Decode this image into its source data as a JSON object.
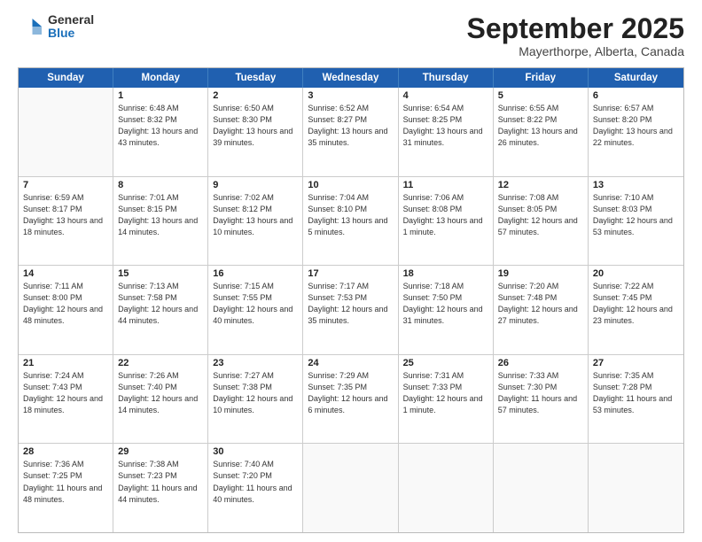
{
  "logo": {
    "general": "General",
    "blue": "Blue"
  },
  "title": "September 2025",
  "location": "Mayerthorpe, Alberta, Canada",
  "days_of_week": [
    "Sunday",
    "Monday",
    "Tuesday",
    "Wednesday",
    "Thursday",
    "Friday",
    "Saturday"
  ],
  "weeks": [
    [
      {
        "day": "",
        "empty": true
      },
      {
        "day": "1",
        "sunrise": "6:48 AM",
        "sunset": "8:32 PM",
        "daylight": "13 hours and 43 minutes."
      },
      {
        "day": "2",
        "sunrise": "6:50 AM",
        "sunset": "8:30 PM",
        "daylight": "13 hours and 39 minutes."
      },
      {
        "day": "3",
        "sunrise": "6:52 AM",
        "sunset": "8:27 PM",
        "daylight": "13 hours and 35 minutes."
      },
      {
        "day": "4",
        "sunrise": "6:54 AM",
        "sunset": "8:25 PM",
        "daylight": "13 hours and 31 minutes."
      },
      {
        "day": "5",
        "sunrise": "6:55 AM",
        "sunset": "8:22 PM",
        "daylight": "13 hours and 26 minutes."
      },
      {
        "day": "6",
        "sunrise": "6:57 AM",
        "sunset": "8:20 PM",
        "daylight": "13 hours and 22 minutes."
      }
    ],
    [
      {
        "day": "7",
        "sunrise": "6:59 AM",
        "sunset": "8:17 PM",
        "daylight": "13 hours and 18 minutes."
      },
      {
        "day": "8",
        "sunrise": "7:01 AM",
        "sunset": "8:15 PM",
        "daylight": "13 hours and 14 minutes."
      },
      {
        "day": "9",
        "sunrise": "7:02 AM",
        "sunset": "8:12 PM",
        "daylight": "13 hours and 10 minutes."
      },
      {
        "day": "10",
        "sunrise": "7:04 AM",
        "sunset": "8:10 PM",
        "daylight": "13 hours and 5 minutes."
      },
      {
        "day": "11",
        "sunrise": "7:06 AM",
        "sunset": "8:08 PM",
        "daylight": "13 hours and 1 minute."
      },
      {
        "day": "12",
        "sunrise": "7:08 AM",
        "sunset": "8:05 PM",
        "daylight": "12 hours and 57 minutes."
      },
      {
        "day": "13",
        "sunrise": "7:10 AM",
        "sunset": "8:03 PM",
        "daylight": "12 hours and 53 minutes."
      }
    ],
    [
      {
        "day": "14",
        "sunrise": "7:11 AM",
        "sunset": "8:00 PM",
        "daylight": "12 hours and 48 minutes."
      },
      {
        "day": "15",
        "sunrise": "7:13 AM",
        "sunset": "7:58 PM",
        "daylight": "12 hours and 44 minutes."
      },
      {
        "day": "16",
        "sunrise": "7:15 AM",
        "sunset": "7:55 PM",
        "daylight": "12 hours and 40 minutes."
      },
      {
        "day": "17",
        "sunrise": "7:17 AM",
        "sunset": "7:53 PM",
        "daylight": "12 hours and 35 minutes."
      },
      {
        "day": "18",
        "sunrise": "7:18 AM",
        "sunset": "7:50 PM",
        "daylight": "12 hours and 31 minutes."
      },
      {
        "day": "19",
        "sunrise": "7:20 AM",
        "sunset": "7:48 PM",
        "daylight": "12 hours and 27 minutes."
      },
      {
        "day": "20",
        "sunrise": "7:22 AM",
        "sunset": "7:45 PM",
        "daylight": "12 hours and 23 minutes."
      }
    ],
    [
      {
        "day": "21",
        "sunrise": "7:24 AM",
        "sunset": "7:43 PM",
        "daylight": "12 hours and 18 minutes."
      },
      {
        "day": "22",
        "sunrise": "7:26 AM",
        "sunset": "7:40 PM",
        "daylight": "12 hours and 14 minutes."
      },
      {
        "day": "23",
        "sunrise": "7:27 AM",
        "sunset": "7:38 PM",
        "daylight": "12 hours and 10 minutes."
      },
      {
        "day": "24",
        "sunrise": "7:29 AM",
        "sunset": "7:35 PM",
        "daylight": "12 hours and 6 minutes."
      },
      {
        "day": "25",
        "sunrise": "7:31 AM",
        "sunset": "7:33 PM",
        "daylight": "12 hours and 1 minute."
      },
      {
        "day": "26",
        "sunrise": "7:33 AM",
        "sunset": "7:30 PM",
        "daylight": "11 hours and 57 minutes."
      },
      {
        "day": "27",
        "sunrise": "7:35 AM",
        "sunset": "7:28 PM",
        "daylight": "11 hours and 53 minutes."
      }
    ],
    [
      {
        "day": "28",
        "sunrise": "7:36 AM",
        "sunset": "7:25 PM",
        "daylight": "11 hours and 48 minutes."
      },
      {
        "day": "29",
        "sunrise": "7:38 AM",
        "sunset": "7:23 PM",
        "daylight": "11 hours and 44 minutes."
      },
      {
        "day": "30",
        "sunrise": "7:40 AM",
        "sunset": "7:20 PM",
        "daylight": "11 hours and 40 minutes."
      },
      {
        "day": "",
        "empty": true
      },
      {
        "day": "",
        "empty": true
      },
      {
        "day": "",
        "empty": true
      },
      {
        "day": "",
        "empty": true
      }
    ]
  ]
}
